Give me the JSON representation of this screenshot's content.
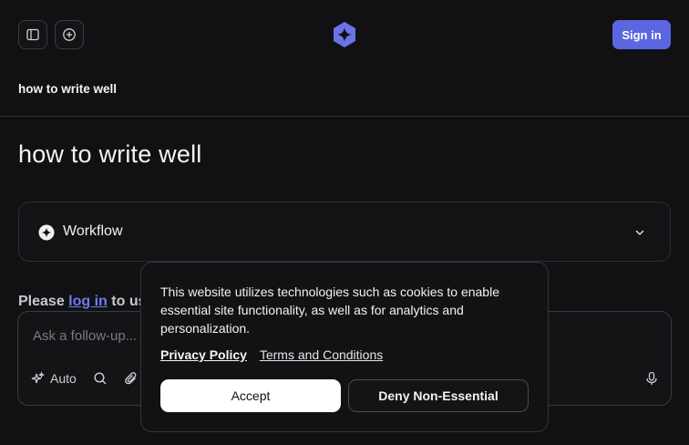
{
  "header": {
    "sidebar_toggle_icon": "sidebar-panel-icon",
    "new_thread_icon": "plus-circle-icon",
    "logo_icon": "sparkle-logo-icon",
    "signin_label": "Sign in",
    "accent_color": "#5b66e0"
  },
  "thread": {
    "breadcrumb_title": "how to write well",
    "title": "how to write well"
  },
  "workflow": {
    "label": "Workflow",
    "icon": "sparkle-badge-icon",
    "expand_icon": "chevron-down-icon"
  },
  "login_prompt": {
    "prefix": "Please",
    "link": "log in",
    "suffix": "to us"
  },
  "composer": {
    "placeholder": "Ask a follow-up...",
    "mode_label": "Auto",
    "mode_icon": "sparkles-icon",
    "search_icon": "search-icon",
    "attach_icon": "paperclip-icon",
    "mic_icon": "microphone-icon"
  },
  "cookie_banner": {
    "message": "This website utilizes technologies such as cookies to enable essential site functionality, as well as for analytics and personalization.",
    "privacy_link": "Privacy Policy",
    "terms_link": "Terms and Conditions",
    "accept_label": "Accept",
    "deny_label": "Deny Non-Essential"
  }
}
